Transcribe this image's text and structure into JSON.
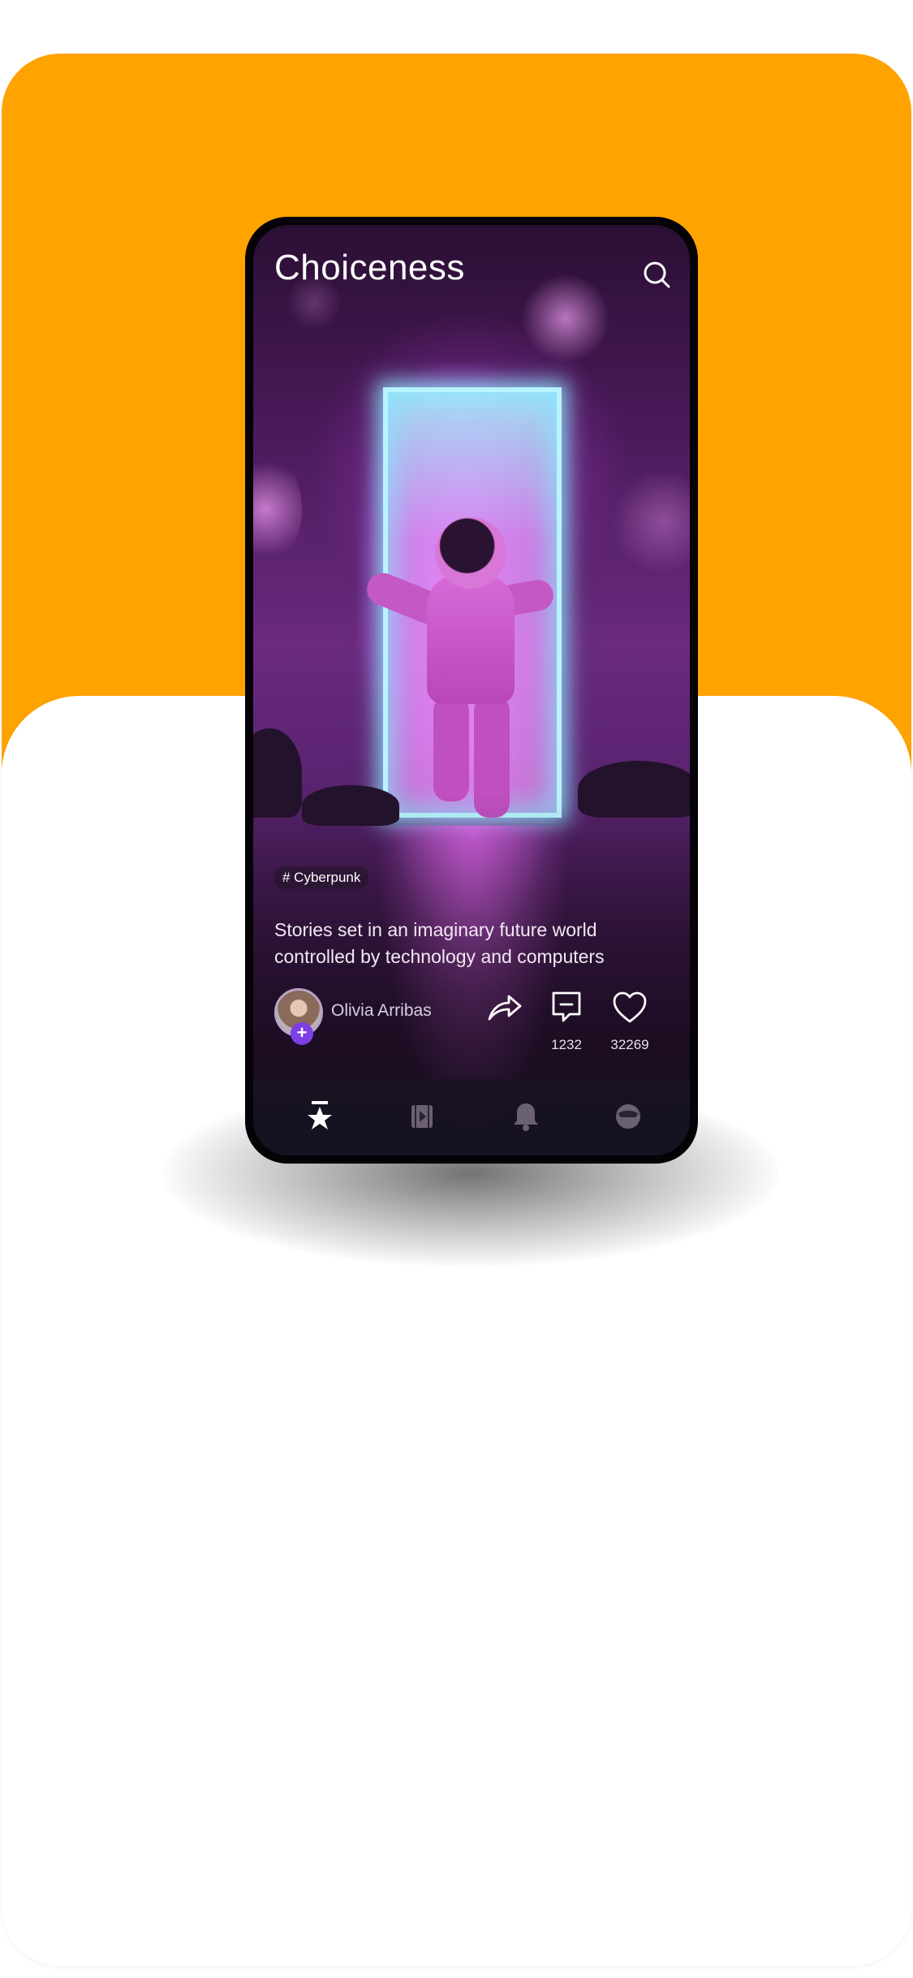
{
  "colors": {
    "backdrop_orange": "#FFA300",
    "accent_purple": "#7b3fe6"
  },
  "header": {
    "title": "Choiceness",
    "search_icon": "search-icon"
  },
  "post": {
    "tag": "# Cyberpunk",
    "description": "Stories set in an imaginary future world controlled by technology and computers",
    "author": {
      "name": "Olivia Arribas",
      "follow_icon": "plus-icon"
    },
    "actions": [
      {
        "name": "share",
        "icon": "share-icon",
        "count": ""
      },
      {
        "name": "comment",
        "icon": "comment-icon",
        "count": "1232"
      },
      {
        "name": "like",
        "icon": "heart-icon",
        "count": "32269"
      }
    ]
  },
  "tabbar": {
    "tabs": [
      {
        "icon": "star-icon",
        "active": true
      },
      {
        "icon": "video-icon",
        "active": false
      },
      {
        "icon": "bell-icon",
        "active": false
      },
      {
        "icon": "profile-icon",
        "active": false
      }
    ]
  }
}
